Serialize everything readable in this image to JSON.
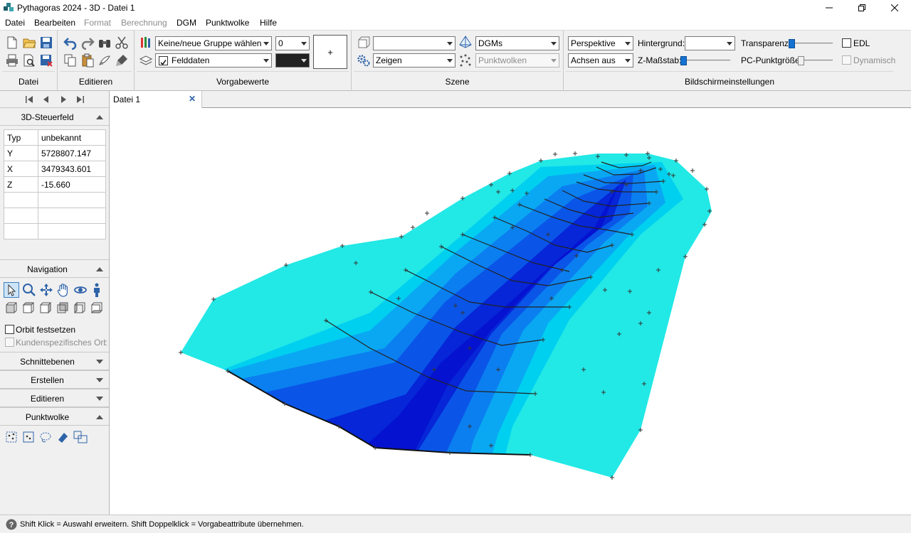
{
  "window": {
    "title": "Pythagoras 2024 - 3D - Datei 1"
  },
  "menu": {
    "items": [
      "Datei",
      "Bearbeiten",
      "Format",
      "Berechnung",
      "DGM",
      "Punktwolke",
      "Hilfe"
    ]
  },
  "ribbon": {
    "groups": {
      "datei": "Datei",
      "editieren": "Editieren",
      "vorgabewerte": "Vorgabewerte",
      "szene": "Szene",
      "bildschirm": "Bildschirmeinstellungen"
    },
    "vorgabe": {
      "gruppe": "Keine/neue Gruppe wählen",
      "nummer": "0",
      "layer": "Felddaten",
      "layer_checked": true,
      "plus": "+"
    },
    "szene": {
      "combo_top": "",
      "dgms": "DGMs",
      "zeigen": "Zeigen",
      "punktwolken": "Punktwolken"
    },
    "bild": {
      "perspektive": "Perspektive",
      "achsen": "Achsen aus",
      "hintergrund_label": "Hintergrund:",
      "hintergrund_value": "",
      "zmassstab_label": "Z-Maßstab:",
      "transparenz_label": "Transparenz:",
      "pc_label": "PC-Punktgröße:",
      "edl_label": "EDL",
      "dynamisch_label": "Dynamisch",
      "transparenz_value": 0,
      "zmassstab_value": 0,
      "pc_value": 0
    }
  },
  "leftpanel": {
    "steuerfeld_title": "3D-Steuerfeld",
    "props": [
      [
        "Typ",
        "unbekannt"
      ],
      [
        "Y",
        "5728807.147"
      ],
      [
        "X",
        "3479343.601"
      ],
      [
        "Z",
        "-15.660"
      ],
      [
        "",
        ""
      ],
      [
        "",
        ""
      ],
      [
        "",
        ""
      ]
    ],
    "navigation_title": "Navigation",
    "orbit_label": "Orbit festsetzen",
    "orbitzentrum_label": "Kundenspezifisches Orbitze",
    "schnittebenen": "Schnittebenen",
    "erstellen": "Erstellen",
    "editieren": "Editieren",
    "punktwolke": "Punktwolke"
  },
  "tabs": [
    {
      "label": "Datei 1",
      "close": "✕"
    }
  ],
  "status": {
    "text": "Shift Klick = Auswahl erweitern. Shift Doppelklick = Vorgabeattribute übernehmen."
  }
}
